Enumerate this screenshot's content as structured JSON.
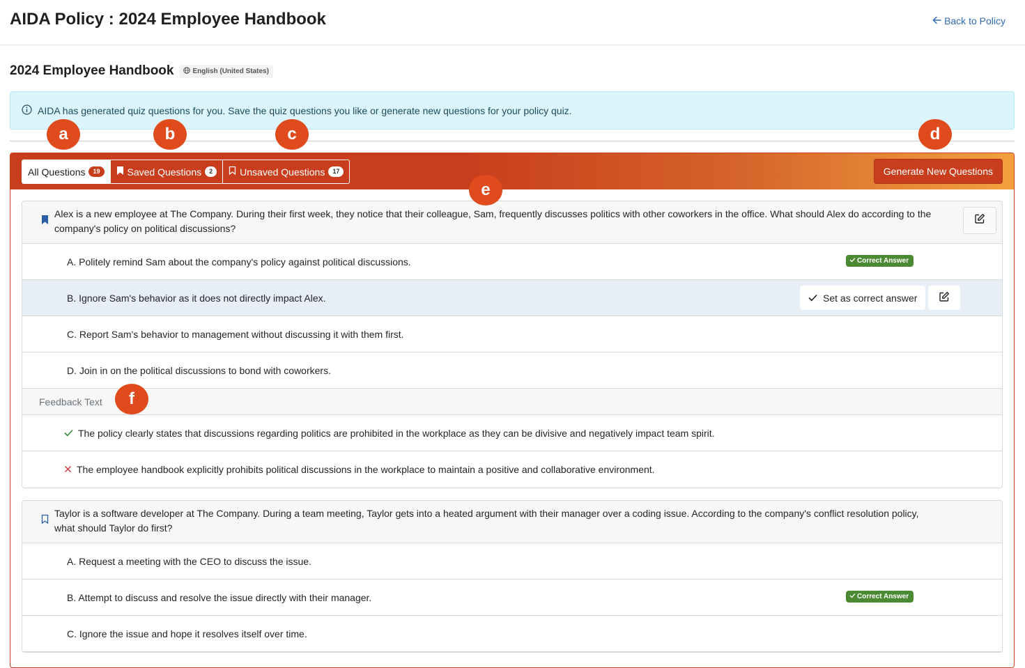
{
  "header": {
    "app_title": "AIDA Policy : 2024 Employee Handbook",
    "back_link": "Back to Policy"
  },
  "document": {
    "title": "2024 Employee Handbook",
    "language": "English (United States)"
  },
  "info_alert": {
    "text": "AIDA has generated quiz questions for you. Save the quiz questions you like or generate new questions for your policy quiz."
  },
  "tabs": [
    {
      "label": "All Questions",
      "count": "19"
    },
    {
      "label": "Saved Questions",
      "count": "2"
    },
    {
      "label": "Unsaved Questions",
      "count": "17"
    }
  ],
  "generate_button": "Generate New Questions",
  "questions": [
    {
      "text": "Alex is a new employee at The Company. During their first week, they notice that their colleague, Sam, frequently discusses politics with other coworkers in the office. What should Alex do according to the company's policy on political discussions?",
      "saved": true,
      "answers": [
        "A. Politely remind Sam about the company's policy against political discussions.",
        "B. Ignore Sam's behavior as it does not directly impact Alex.",
        "C. Report Sam's behavior to management without discussing it with them first.",
        "D. Join in on the political discussions to bond with coworkers."
      ],
      "feedback_label": "Feedback Text",
      "feedback_correct": "The policy clearly states that discussions regarding politics are prohibited in the workplace as they can be divisive and negatively impact team spirit.",
      "feedback_incorrect": "The employee handbook explicitly prohibits political discussions in the workplace to maintain a positive and collaborative environment."
    },
    {
      "text": "Taylor is a software developer at The Company. During a team meeting, Taylor gets into a heated argument with their manager over a coding issue. According to the company's conflict resolution policy, what should Taylor do first?",
      "saved": false,
      "answers": [
        "A. Request a meeting with the CEO to discuss the issue.",
        "B. Attempt to discuss and resolve the issue directly with their manager.",
        "C. Ignore the issue and hope it resolves itself over time."
      ]
    }
  ],
  "labels": {
    "correct_answer": "Correct Answer",
    "set_correct": "Set as correct answer"
  },
  "markers": [
    "a",
    "b",
    "c",
    "d",
    "e",
    "f"
  ],
  "colors": {
    "accent": "#c83d1c",
    "marker": "#e04b1d",
    "correct_badge": "#4b8a33",
    "info_bg": "#dcf5fc",
    "link": "#2f6ab3"
  }
}
